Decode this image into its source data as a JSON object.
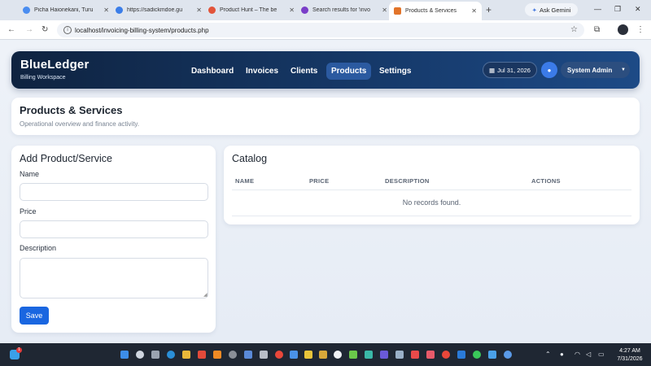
{
  "browser": {
    "tabs": [
      {
        "title": "Picha Haionekani, Turu",
        "color": "#4a8df0"
      },
      {
        "title": "https://sadickmdoe.gu",
        "color": "#3c7ee8"
      },
      {
        "title": "Product Hunt – The be",
        "color": "#e2543a"
      },
      {
        "title": "Search results for 'invo",
        "color": "#7a3ec8"
      },
      {
        "title": "Products & Services",
        "color": "#e2742a"
      }
    ],
    "new_tab": "+",
    "ask_gemini": "Ask Gemini",
    "url": "localhost/invoicing-billing-system/products.php"
  },
  "app": {
    "brand": "BlueLedger",
    "brand_sub": "Billing Workspace",
    "nav": [
      {
        "label": "Dashboard"
      },
      {
        "label": "Invoices"
      },
      {
        "label": "Clients"
      },
      {
        "label": "Products",
        "active": true
      },
      {
        "label": "Settings"
      }
    ],
    "date": "Jul 31, 2026",
    "user": "System Admin",
    "accent": "#1a66e0"
  },
  "page": {
    "title": "Products & Services",
    "subtitle": "Operational overview and finance activity."
  },
  "form": {
    "title": "Add Product/Service",
    "name_label": "Name",
    "price_label": "Price",
    "description_label": "Description",
    "name_value": "",
    "price_value": "",
    "description_value": "",
    "save_label": "Save"
  },
  "catalog": {
    "title": "Catalog",
    "columns": [
      "NAME",
      "PRICE",
      "DESCRIPTION",
      "ACTIONS"
    ],
    "empty_text": "No records found."
  },
  "taskbar": {
    "time": "4:27 AM",
    "date": "7/31/2026",
    "notification_count": "1"
  }
}
